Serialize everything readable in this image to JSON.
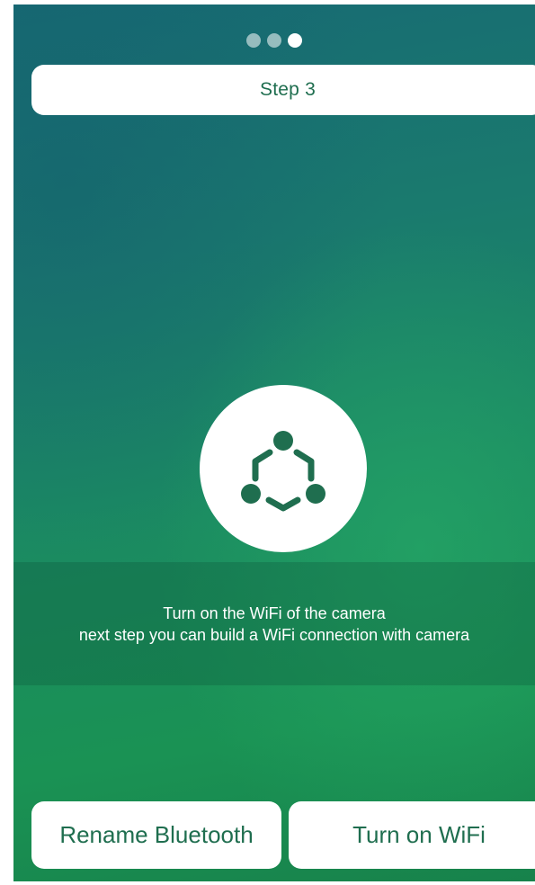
{
  "pager": {
    "total": 3,
    "current": 3
  },
  "step": {
    "label": "Step 3"
  },
  "hero": {
    "icon": "connection-hub-icon"
  },
  "info": {
    "line1": "Turn on the WiFi of the camera",
    "line2": "next step you can build a WiFi connection with camera"
  },
  "actions": {
    "rename_label": "Rename Bluetooth",
    "wifi_label": "Turn on WiFi"
  },
  "colors": {
    "accent_text": "#1f6e4f",
    "background_start": "#176a73",
    "background_end": "#1a9254",
    "surface": "#ffffff"
  }
}
